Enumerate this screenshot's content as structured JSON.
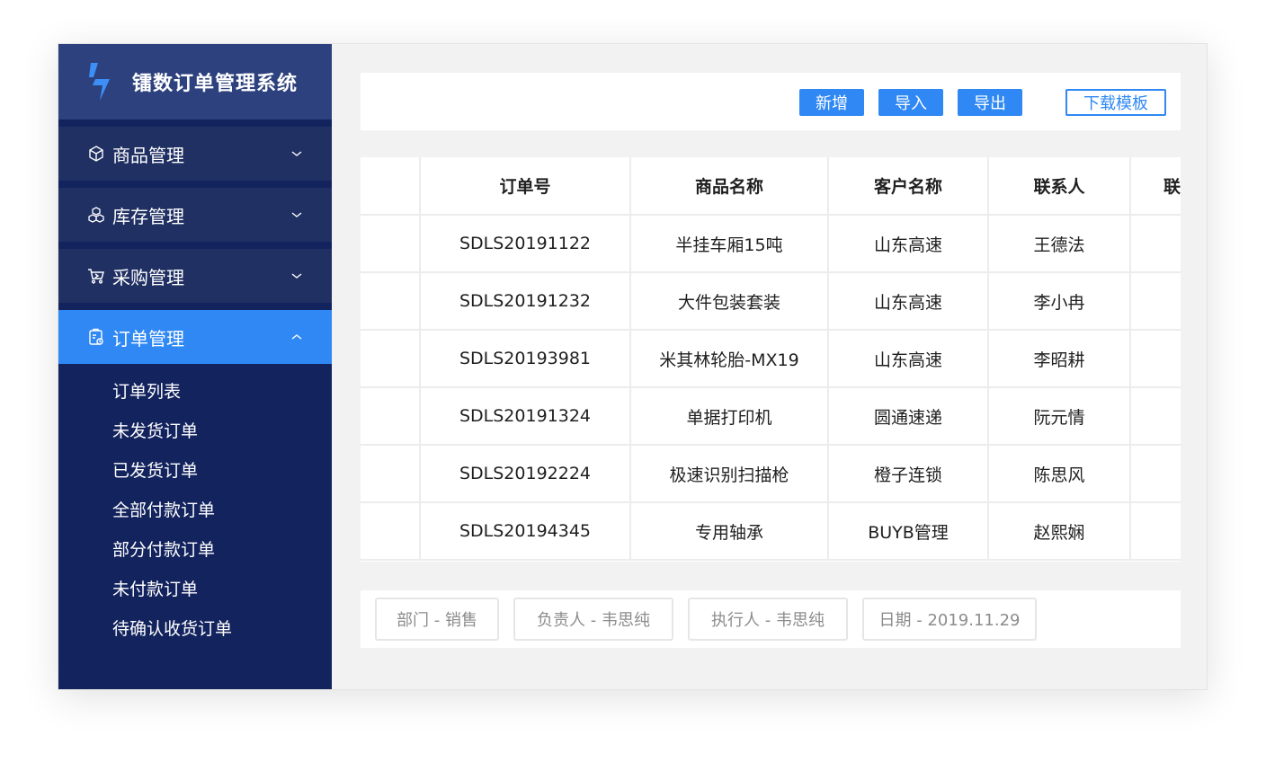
{
  "app": {
    "title": "镭数订单管理系统",
    "accent_color": "#2f88f3",
    "sidebar_color": "#13235e"
  },
  "sidebar": {
    "groups": [
      {
        "label": "商品管理",
        "icon": "box-icon",
        "expanded": false
      },
      {
        "label": "库存管理",
        "icon": "cubes-icon",
        "expanded": false
      },
      {
        "label": "采购管理",
        "icon": "cart-icon",
        "expanded": false
      },
      {
        "label": "订单管理",
        "icon": "clipboard-icon",
        "expanded": true
      }
    ],
    "order_submenu": [
      "订单列表",
      "未发货订单",
      "已发货订单",
      "全部付款订单",
      "部分付款订单",
      "未付款订单",
      "待确认收货订单"
    ]
  },
  "toolbar": {
    "add_label": "新增",
    "import_label": "导入",
    "export_label": "导出",
    "template_label": "下载模板"
  },
  "table": {
    "columns": [
      "",
      "订单号",
      "商品名称",
      "客户名称",
      "联系人",
      "联"
    ],
    "rows": [
      [
        "SDLS20191122",
        "半挂车厢15吨",
        "山东高速",
        "王德法"
      ],
      [
        "SDLS20191232",
        "大件包装套装",
        "山东高速",
        "李小冉"
      ],
      [
        "SDLS20193981",
        "米其林轮胎-MX19",
        "山东高速",
        "李昭耕"
      ],
      [
        "SDLS20191324",
        "单据打印机",
        "圆通速递",
        "阮元情"
      ],
      [
        "SDLS20192224",
        "极速识别扫描枪",
        "橙子连锁",
        "陈思风"
      ],
      [
        "SDLS20194345",
        "专用轴承",
        "BUYB管理",
        "赵熙娴"
      ]
    ]
  },
  "filters": [
    "部门 - 销售",
    "负责人 - 韦思纯",
    "执行人 - 韦思纯",
    "日期 - 2019.11.29"
  ]
}
